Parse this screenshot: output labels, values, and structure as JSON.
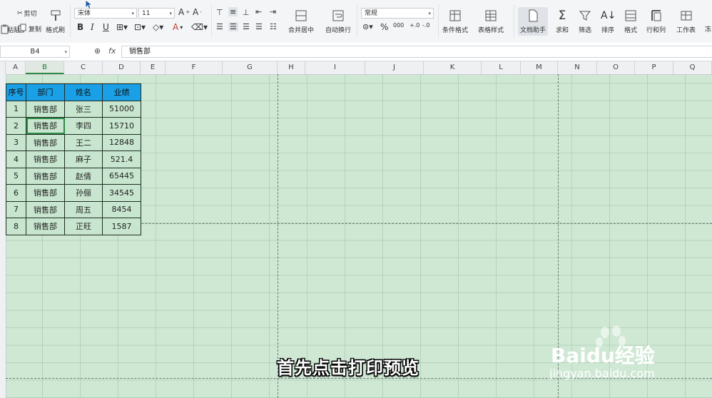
{
  "ribbon": {
    "paste_label": "粘贴",
    "cut_label": "剪切",
    "copy_label": "复制",
    "format_painter_label": "格式刷",
    "font_name": "宋体",
    "font_size": "11",
    "merge_center_label": "合并居中",
    "wrap_text_label": "自动换行",
    "number_format": "常规",
    "conditional_format_label": "条件格式",
    "table_style_label": "表格样式",
    "doc_assistant_label": "文档助手",
    "sum_label": "求和",
    "filter_label": "筛选",
    "sort_label": "排序",
    "format_label": "格式",
    "rows_cols_label": "行和列",
    "worksheet_label": "工作表",
    "freeze_label": "冻"
  },
  "formula_bar": {
    "cell_ref": "B4",
    "fx_label": "fx",
    "content": "销售部"
  },
  "columns": [
    "A",
    "B",
    "C",
    "D",
    "E",
    "F",
    "G",
    "H",
    "I",
    "J",
    "K",
    "L",
    "M",
    "N",
    "O",
    "P",
    "Q"
  ],
  "table": {
    "headers": [
      "序号",
      "部门",
      "姓名",
      "业绩"
    ],
    "rows": [
      [
        "1",
        "销售部",
        "张三",
        "51000"
      ],
      [
        "2",
        "销售部",
        "李四",
        "15710"
      ],
      [
        "3",
        "销售部",
        "王二",
        "12848"
      ],
      [
        "4",
        "销售部",
        "麻子",
        "521.4"
      ],
      [
        "5",
        "销售部",
        "赵倩",
        "65445"
      ],
      [
        "6",
        "销售部",
        "孙俪",
        "34545"
      ],
      [
        "7",
        "销售部",
        "周五",
        "8454"
      ],
      [
        "8",
        "销售部",
        "正旺",
        "1587"
      ]
    ]
  },
  "subtitle": "首先点击打印预览",
  "watermark": {
    "brand": "Baidu经验",
    "url": "jingyan.baidu.com"
  },
  "colors": {
    "sheet_bg": "#cfe8d4",
    "header_fill": "#1aa0e6",
    "selection": "#2e8b45"
  }
}
